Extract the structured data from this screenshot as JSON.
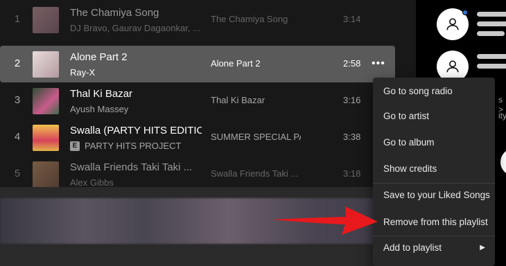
{
  "tracks": [
    {
      "num": "1",
      "title": "The Chamiya Song",
      "artist": "DJ Bravo, Gaurav Dagaonkar, ...",
      "album": "The Chamiya Song",
      "duration": "3:14",
      "explicit": false,
      "art_color": "#b9888f"
    },
    {
      "num": "2",
      "title": "Alone Part 2",
      "artist": "Ray-X",
      "album": "Alone Part 2",
      "duration": "2:58",
      "explicit": false,
      "art_color": "#d7c9c9"
    },
    {
      "num": "3",
      "title": "Thal Ki Bazar",
      "artist": "Ayush Massey",
      "album": "Thal Ki Bazar",
      "duration": "3:16",
      "explicit": false,
      "art_color": "#3f6b4a"
    },
    {
      "num": "4",
      "title": "Swalla (PARTY HITS EDITION)",
      "artist": "PARTY HITS PROJECT",
      "album": "SUMMER SPECIAL PARTY",
      "duration": "3:38",
      "explicit": true,
      "explicit_label": "E",
      "art_color": "#e3b24a"
    },
    {
      "num": "5",
      "title": "Swalla Friends Taki Taki ...",
      "artist": "Alex Gibbs",
      "album": "Swalla Friends Taki ...",
      "duration": "3:18",
      "explicit": false,
      "art_color": "#8d6b55"
    }
  ],
  "more_label": "•••",
  "context_menu": {
    "items": [
      {
        "label": "Go to song radio"
      },
      {
        "label": "Go to artist"
      },
      {
        "label": "Go to album"
      },
      {
        "label": "Show credits"
      },
      {
        "label": "Save to your Liked Songs"
      },
      {
        "label": "Remove from this playlist"
      },
      {
        "label": "Add to playlist",
        "submenu": true,
        "chevron": "▶"
      }
    ]
  },
  "sidebar": {
    "fragment_1": "s >",
    "fragment_2": "ity"
  },
  "annotation": {
    "color": "#e8191c"
  },
  "colors": {
    "selected_row": "#5a5a5a",
    "menu_bg": "#282828",
    "notification_dot": "#2e77d0"
  }
}
